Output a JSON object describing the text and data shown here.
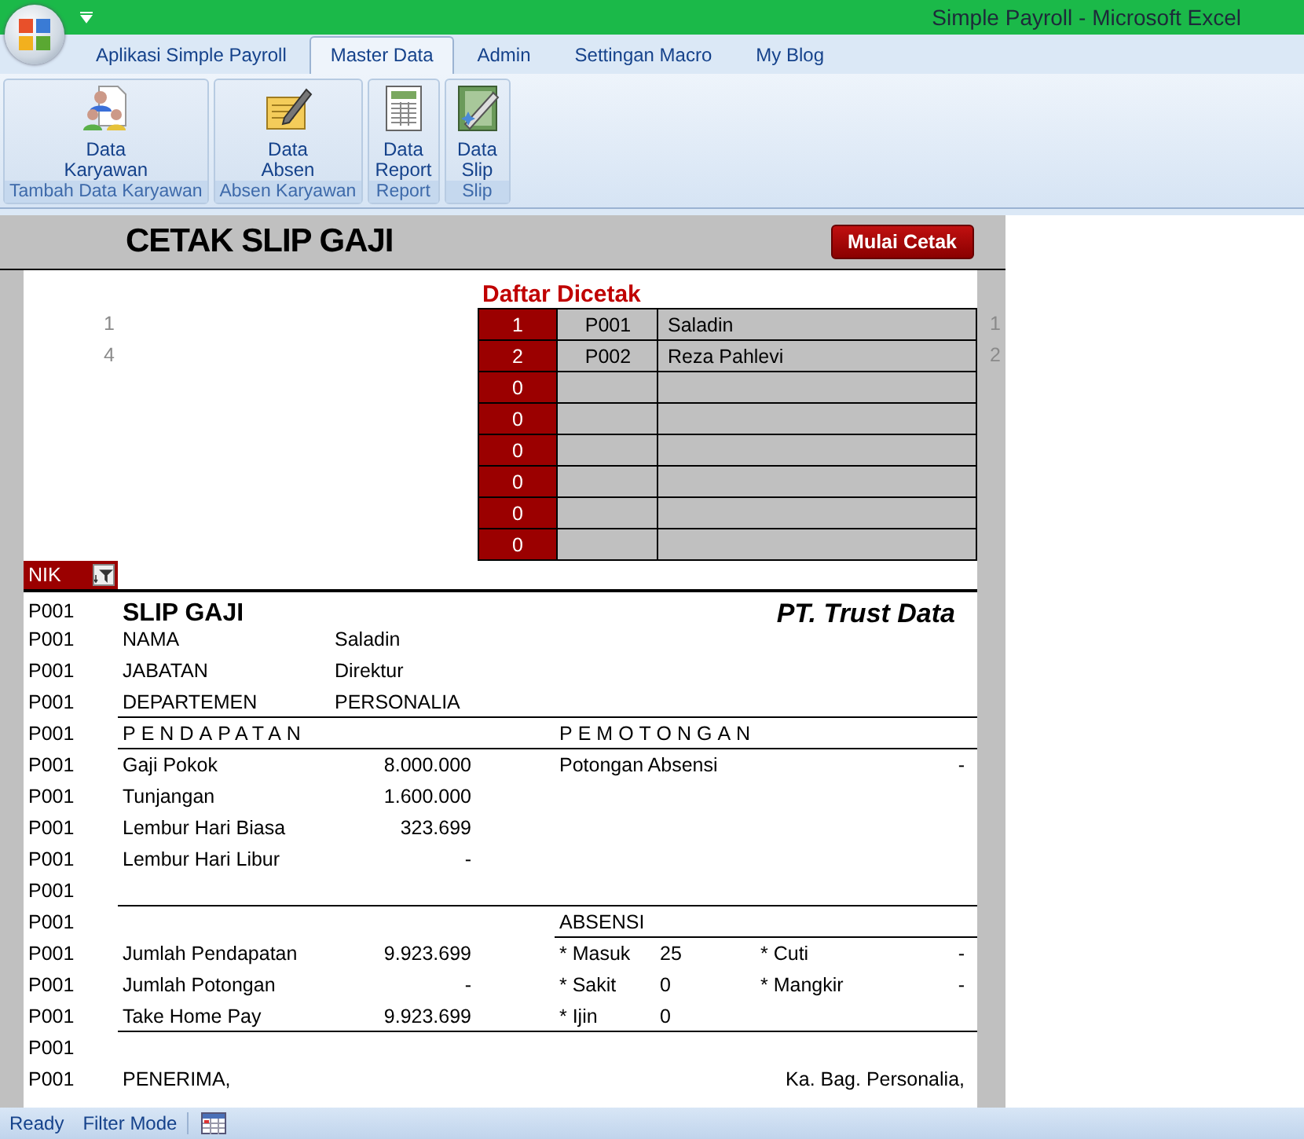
{
  "window": {
    "title": "Simple Payroll - Microsoft Excel"
  },
  "tabs": [
    {
      "label": "Aplikasi Simple Payroll",
      "selected": false
    },
    {
      "label": "Master Data",
      "selected": true
    },
    {
      "label": "Admin",
      "selected": false
    },
    {
      "label": "Settingan Macro",
      "selected": false
    },
    {
      "label": "My Blog",
      "selected": false
    }
  ],
  "ribbon": {
    "groups": [
      {
        "label": "Tambah Data Karyawan",
        "button": {
          "label": "Data Karyawan",
          "kind": "people"
        }
      },
      {
        "label": "Absen Karyawan",
        "button": {
          "label": "Data Absen",
          "kind": "notepad"
        }
      },
      {
        "label": "Report",
        "button": {
          "label": "Data Report",
          "kind": "report"
        }
      },
      {
        "label": "Slip",
        "button": {
          "label": "Data Slip",
          "kind": "slip"
        }
      }
    ]
  },
  "sheet": {
    "title": "CETAK SLIP GAJI",
    "print_button": "Mulai Cetak",
    "list_title": "Daftar Dicetak",
    "list_rows": [
      {
        "no": "1",
        "nik": "P001",
        "name": "Saladin",
        "left_note": "1",
        "right_note": "1"
      },
      {
        "no": "2",
        "nik": "P002",
        "name": "Reza Pahlevi",
        "left_note": "4",
        "right_note": "2"
      },
      {
        "no": "0"
      },
      {
        "no": "0"
      },
      {
        "no": "0"
      },
      {
        "no": "0"
      },
      {
        "no": "0"
      },
      {
        "no": "0"
      }
    ],
    "filter_header": "NIK",
    "slip_rows": [
      {
        "nik": "P001",
        "kind": "title",
        "title": "SLIP GAJI",
        "company": "PT. Trust Data",
        "underline": false
      },
      {
        "nik": "P001",
        "kind": "info",
        "label": "NAMA",
        "value": "Saladin",
        "underline": false
      },
      {
        "nik": "P001",
        "kind": "info",
        "label": "JABATAN",
        "value": "Direktur",
        "underline": false
      },
      {
        "nik": "P001",
        "kind": "info",
        "label": "DEPARTEMEN",
        "value": "PERSONALIA",
        "underline": true
      },
      {
        "nik": "P001",
        "kind": "section",
        "left": "PENDAPATAN",
        "right": "PEMOTONGAN",
        "underline": true
      },
      {
        "nik": "P001",
        "kind": "item",
        "label": "Gaji Pokok",
        "value": "8.000.000",
        "right_label": "Potongan Absensi",
        "right_value": "-",
        "underline": false
      },
      {
        "nik": "P001",
        "kind": "item",
        "label": "Tunjangan",
        "value": "1.600.000",
        "underline": false
      },
      {
        "nik": "P001",
        "kind": "item",
        "label": "Lembur Hari Biasa",
        "value": "323.699",
        "underline": false
      },
      {
        "nik": "P001",
        "kind": "item",
        "label": "Lembur Hari Libur",
        "value": "-",
        "underline": false
      },
      {
        "nik": "P001",
        "kind": "blank",
        "underline": true
      },
      {
        "nik": "P001",
        "kind": "absensi",
        "right": "ABSENSI",
        "underline": true
      },
      {
        "nik": "P001",
        "kind": "summary",
        "label": "Jumlah Pendapatan",
        "value": "9.923.699",
        "a_label": "* Masuk",
        "a_value": "25",
        "b_label": "* Cuti",
        "b_value": "-",
        "underline": false
      },
      {
        "nik": "P001",
        "kind": "summary",
        "label": "Jumlah Potongan",
        "value": "-",
        "a_label": "* Sakit",
        "a_value": "0",
        "b_label": "* Mangkir",
        "b_value": "-",
        "underline": false
      },
      {
        "nik": "P001",
        "kind": "summary",
        "label": "Take Home Pay",
        "value": "9.923.699",
        "a_label": "* Ijin",
        "a_value": "0",
        "underline": true
      },
      {
        "nik": "P001",
        "kind": "blank",
        "underline": false
      },
      {
        "nik": "P001",
        "kind": "sign",
        "left": "PENERIMA,",
        "right": "Ka. Bag. Personalia,",
        "underline": false
      }
    ]
  },
  "status_bar": {
    "items": [
      "Ready",
      "Filter Mode"
    ]
  }
}
